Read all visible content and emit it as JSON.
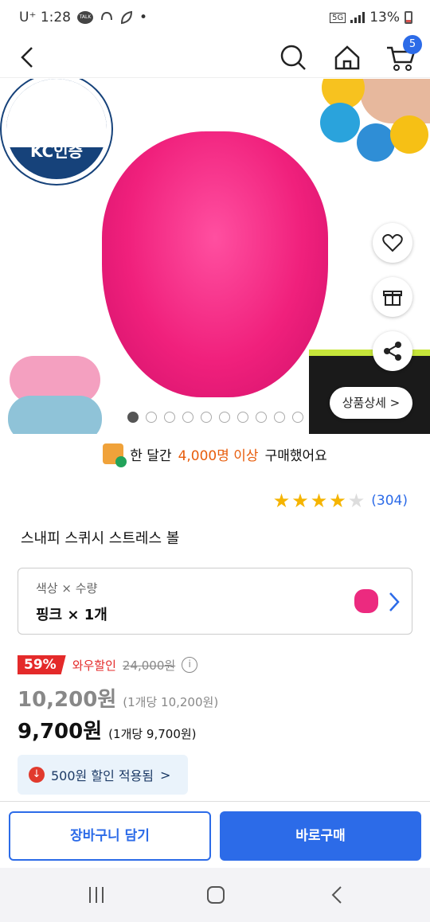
{
  "status": {
    "carrier": "U⁺ 1:28",
    "talk": "TALK",
    "dot": "•",
    "network": "5G",
    "battery": "13%"
  },
  "header": {
    "cart_count": "5"
  },
  "hero": {
    "kc_label": "KC인증",
    "detail_button": "상품상세 >"
  },
  "buyers": {
    "prefix": "한 달간",
    "count": "4,000명 이상",
    "suffix": "구매했어요"
  },
  "rating": {
    "stars": 4,
    "count": "(304)"
  },
  "product": {
    "title": "스내피 스퀴시 스트레스 볼"
  },
  "option": {
    "label": "색상 × 수량",
    "value": "핑크 × 1개"
  },
  "pricing": {
    "discount_rate": "59%",
    "discount_name": "와우할인",
    "original_price": "24,000원",
    "price": "10,200원",
    "price_unit": "(1개당 10,200원)",
    "final_price": "9,700원",
    "final_unit": "(1개당 9,700원)"
  },
  "coupon": {
    "text": "500원 할인 적용됨",
    "chevron": ">"
  },
  "actions": {
    "cart_label": "장바구니 담기",
    "buy_label": "바로구매"
  },
  "colors": {
    "accent": "#2c6be8",
    "discount": "#e42a2a",
    "highlight": "#e85d0c"
  }
}
